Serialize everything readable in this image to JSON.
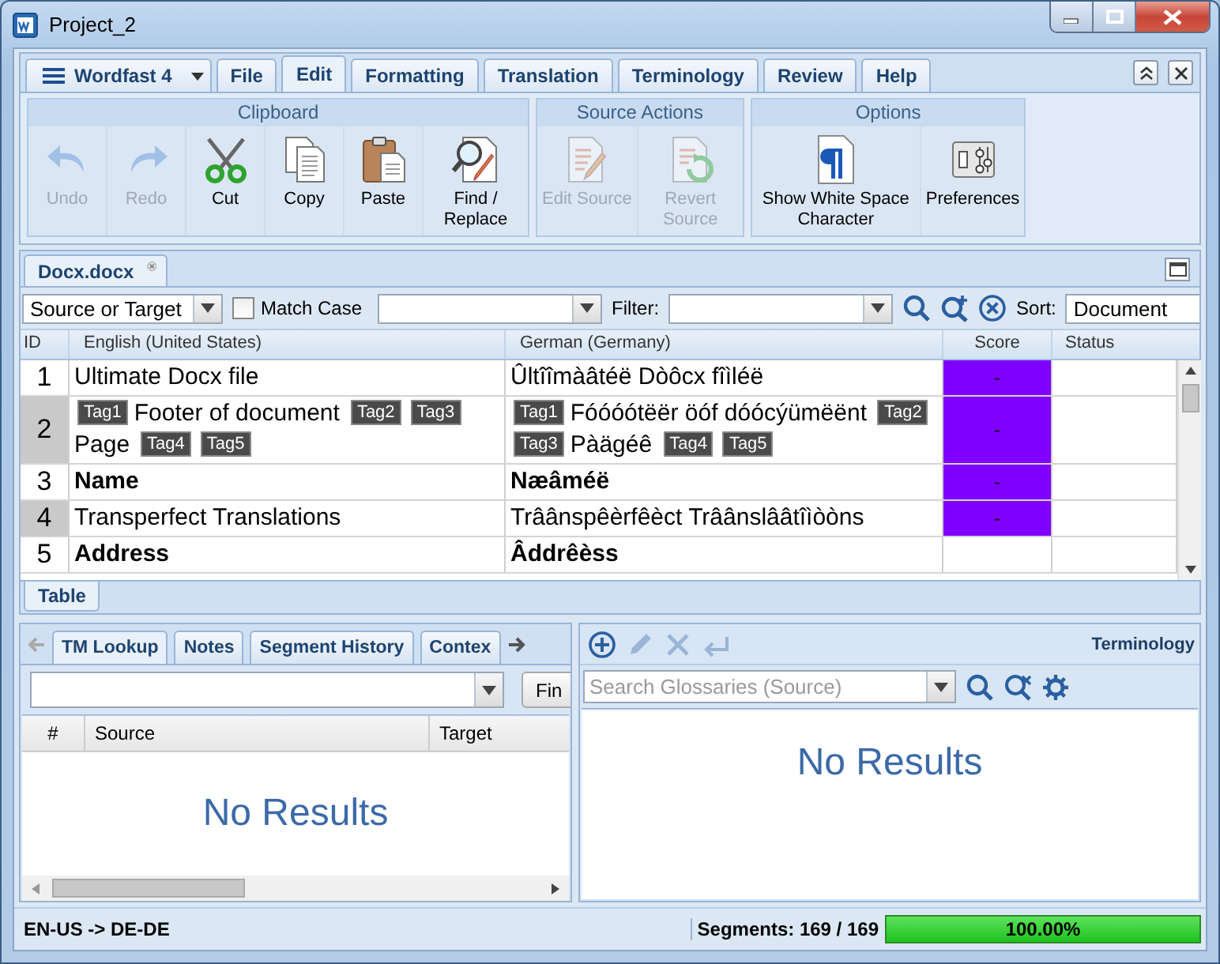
{
  "window": {
    "title": "Project_2"
  },
  "app_menu": {
    "label": "Wordfast 4"
  },
  "ribbon_tabs": [
    {
      "label": "File",
      "selected": false
    },
    {
      "label": "Edit",
      "selected": true
    },
    {
      "label": "Formatting",
      "selected": false
    },
    {
      "label": "Translation",
      "selected": false
    },
    {
      "label": "Terminology",
      "selected": false
    },
    {
      "label": "Review",
      "selected": false
    },
    {
      "label": "Help",
      "selected": false
    }
  ],
  "ribbon_groups": [
    {
      "title": "Clipboard",
      "buttons": [
        {
          "kind": "undo",
          "label": "Undo",
          "disabled": true
        },
        {
          "kind": "redo",
          "label": "Redo",
          "disabled": true
        },
        {
          "kind": "cut",
          "label": "Cut",
          "disabled": false
        },
        {
          "kind": "copy",
          "label": "Copy",
          "disabled": false
        },
        {
          "kind": "paste",
          "label": "Paste",
          "disabled": false
        },
        {
          "kind": "find",
          "label": "Find / Replace",
          "disabled": false
        }
      ]
    },
    {
      "title": "Source Actions",
      "buttons": [
        {
          "kind": "edit",
          "label": "Edit Source",
          "disabled": true
        },
        {
          "kind": "revert",
          "label": "Revert Source",
          "disabled": true
        }
      ]
    },
    {
      "title": "Options",
      "buttons": [
        {
          "kind": "pilcrow",
          "label": "Show White Space Character",
          "disabled": false
        },
        {
          "kind": "preferences",
          "label": "Preferences",
          "disabled": false
        }
      ]
    }
  ],
  "document_tabs": [
    {
      "label": "Docx.docx",
      "selected": true
    }
  ],
  "filter_bar": {
    "scope": "Source or Target",
    "match_case": {
      "label": "Match Case",
      "checked": false
    },
    "filter_label": "Filter:",
    "sort_label": "Sort:",
    "sort_value": "Document"
  },
  "grid": {
    "columns": [
      "ID",
      "English (United States)",
      "German (Germany)",
      "Score",
      "Status"
    ],
    "rows": [
      {
        "id": "1",
        "bold": false,
        "score": "-",
        "color": "#8000ff",
        "source": [
          {
            "kind": "text",
            "text": "Ultimate Docx file"
          }
        ],
        "target": [
          {
            "kind": "text",
            "text": "Ûltîîmàâtéë Dòôcx fîìléë"
          }
        ]
      },
      {
        "id": "2",
        "bold": false,
        "score": "-",
        "color": "#8000ff",
        "source": [
          {
            "kind": "tag",
            "text": "Tag1"
          },
          {
            "kind": "text",
            "text": "Footer of document"
          },
          {
            "kind": "tag",
            "text": "Tag2"
          },
          {
            "kind": "tag",
            "text": "Tag3"
          },
          {
            "kind": "text",
            "text": "Page"
          },
          {
            "kind": "tag",
            "text": "Tag4"
          },
          {
            "kind": "tag",
            "text": "Tag5"
          }
        ],
        "target": [
          {
            "kind": "tag",
            "text": "Tag1"
          },
          {
            "kind": "text",
            "text": "Fóóóótëër öóf dóócýümëënt"
          },
          {
            "kind": "tag",
            "text": "Tag2"
          },
          {
            "kind": "tag",
            "text": "Tag3"
          },
          {
            "kind": "text",
            "text": "Pàägéê"
          },
          {
            "kind": "tag",
            "text": "Tag4"
          },
          {
            "kind": "tag",
            "text": "Tag5"
          }
        ]
      },
      {
        "id": "3",
        "bold": true,
        "score": "-",
        "color": "#8000ff",
        "source": [
          {
            "kind": "text",
            "text": "Name"
          }
        ],
        "target": [
          {
            "kind": "text",
            "text": "Næâméë"
          }
        ]
      },
      {
        "id": "4",
        "bold": false,
        "score": "-",
        "color": "#8000ff",
        "source": [
          {
            "kind": "text",
            "text": "Transperfect Translations"
          }
        ],
        "target": [
          {
            "kind": "text",
            "text": "Trâânspêèrfêèct Trâânslââtîìòòns"
          }
        ]
      },
      {
        "id": "5",
        "bold": true,
        "source": [
          {
            "kind": "text",
            "text": "Address"
          }
        ],
        "target": [
          {
            "kind": "text",
            "text": "Âddrêèss"
          }
        ]
      }
    ]
  },
  "view_tabs": [
    {
      "label": "Table",
      "selected": true
    }
  ],
  "lookup_panel": {
    "tabs": [
      {
        "label": "TM Lookup",
        "selected": true
      },
      {
        "label": "Notes",
        "selected": false
      },
      {
        "label": "Segment History",
        "selected": false
      },
      {
        "label": "Contex",
        "selected": false
      }
    ],
    "find_button": "Fin",
    "columns": [
      "#",
      "Source",
      "Target"
    ],
    "empty_text": "No Results"
  },
  "terminology_panel": {
    "title": "Terminology",
    "tools": [
      {
        "kind": "add",
        "disabled": false
      },
      {
        "kind": "edit",
        "disabled": true
      },
      {
        "kind": "delete",
        "disabled": true
      },
      {
        "kind": "insert",
        "disabled": true
      }
    ],
    "search": {
      "placeholder": "Search Glossaries (Source)"
    },
    "empty_text": "No Results"
  },
  "status_bar": {
    "language_pair": "EN-US -> DE-DE",
    "segments": "Segments: 169 / 169",
    "progress": {
      "level": 1,
      "reading": "100.00%"
    }
  }
}
